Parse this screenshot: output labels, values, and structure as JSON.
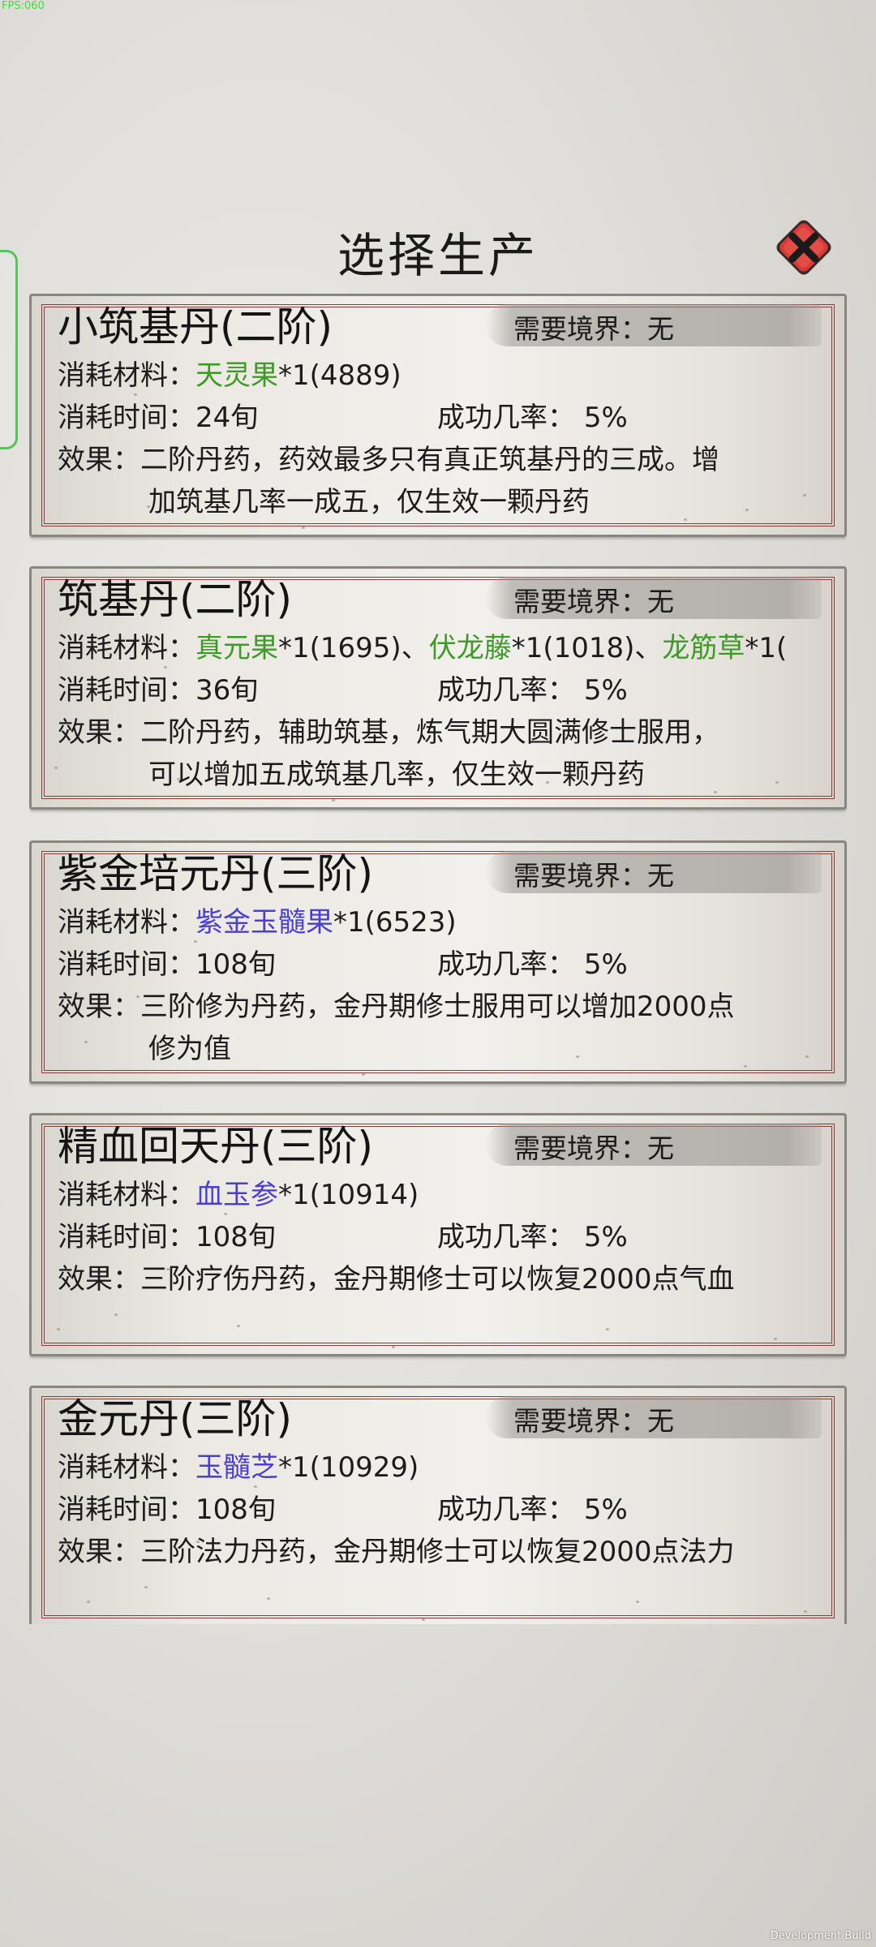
{
  "fps": "FPS:060",
  "dev_build": "Development Build",
  "title": "选择生产",
  "labels": {
    "materials": "消耗材料：",
    "time": "消耗时间：",
    "rate": "成功几率：",
    "effect": "效果：",
    "realm": "需要境界："
  },
  "colors": {
    "green_material": "#3e9a28",
    "blue_material": "#4b3fcf",
    "card_border": "#8b3b35",
    "close_button": "#d83a3a"
  },
  "recipes": [
    {
      "name": "小筑基丹(二阶)",
      "realm": "无",
      "materials": [
        {
          "name": "天灵果",
          "suffix": "*1(4889)",
          "color": "green"
        }
      ],
      "time": "24旬",
      "rate": "5%",
      "effect_line1": "二阶丹药，药效最多只有真正筑基丹的三成。增",
      "effect_line2": "加筑基几率一成五，仅生效一颗丹药"
    },
    {
      "name": "筑基丹(二阶)",
      "realm": "无",
      "materials": [
        {
          "name": "真元果",
          "suffix": "*1(1695)、",
          "color": "green"
        },
        {
          "name": "伏龙藤",
          "suffix": "*1(1018)、",
          "color": "green"
        },
        {
          "name": "龙筋草",
          "suffix": "*1(",
          "color": "green"
        }
      ],
      "time": "36旬",
      "rate": "5%",
      "effect_line1": "二阶丹药，辅助筑基，炼气期大圆满修士服用，",
      "effect_line2": "可以增加五成筑基几率，仅生效一颗丹药"
    },
    {
      "name": "紫金培元丹(三阶)",
      "realm": "无",
      "materials": [
        {
          "name": "紫金玉髓果",
          "suffix": "*1(6523)",
          "color": "blue"
        }
      ],
      "time": "108旬",
      "rate": "5%",
      "effect_line1": "三阶修为丹药，金丹期修士服用可以增加2000点",
      "effect_line2": "修为值"
    },
    {
      "name": "精血回天丹(三阶)",
      "realm": "无",
      "materials": [
        {
          "name": "血玉参",
          "suffix": "*1(10914)",
          "color": "blue"
        }
      ],
      "time": "108旬",
      "rate": "5%",
      "effect_line1": "三阶疗伤丹药，金丹期修士可以恢复2000点气血",
      "effect_line2": ""
    },
    {
      "name": "金元丹(三阶)",
      "realm": "无",
      "materials": [
        {
          "name": "玉髓芝",
          "suffix": "*1(10929)",
          "color": "blue"
        }
      ],
      "time": "108旬",
      "rate": "5%",
      "effect_line1": "三阶法力丹药，金丹期修士可以恢复2000点法力",
      "effect_line2": ""
    }
  ]
}
